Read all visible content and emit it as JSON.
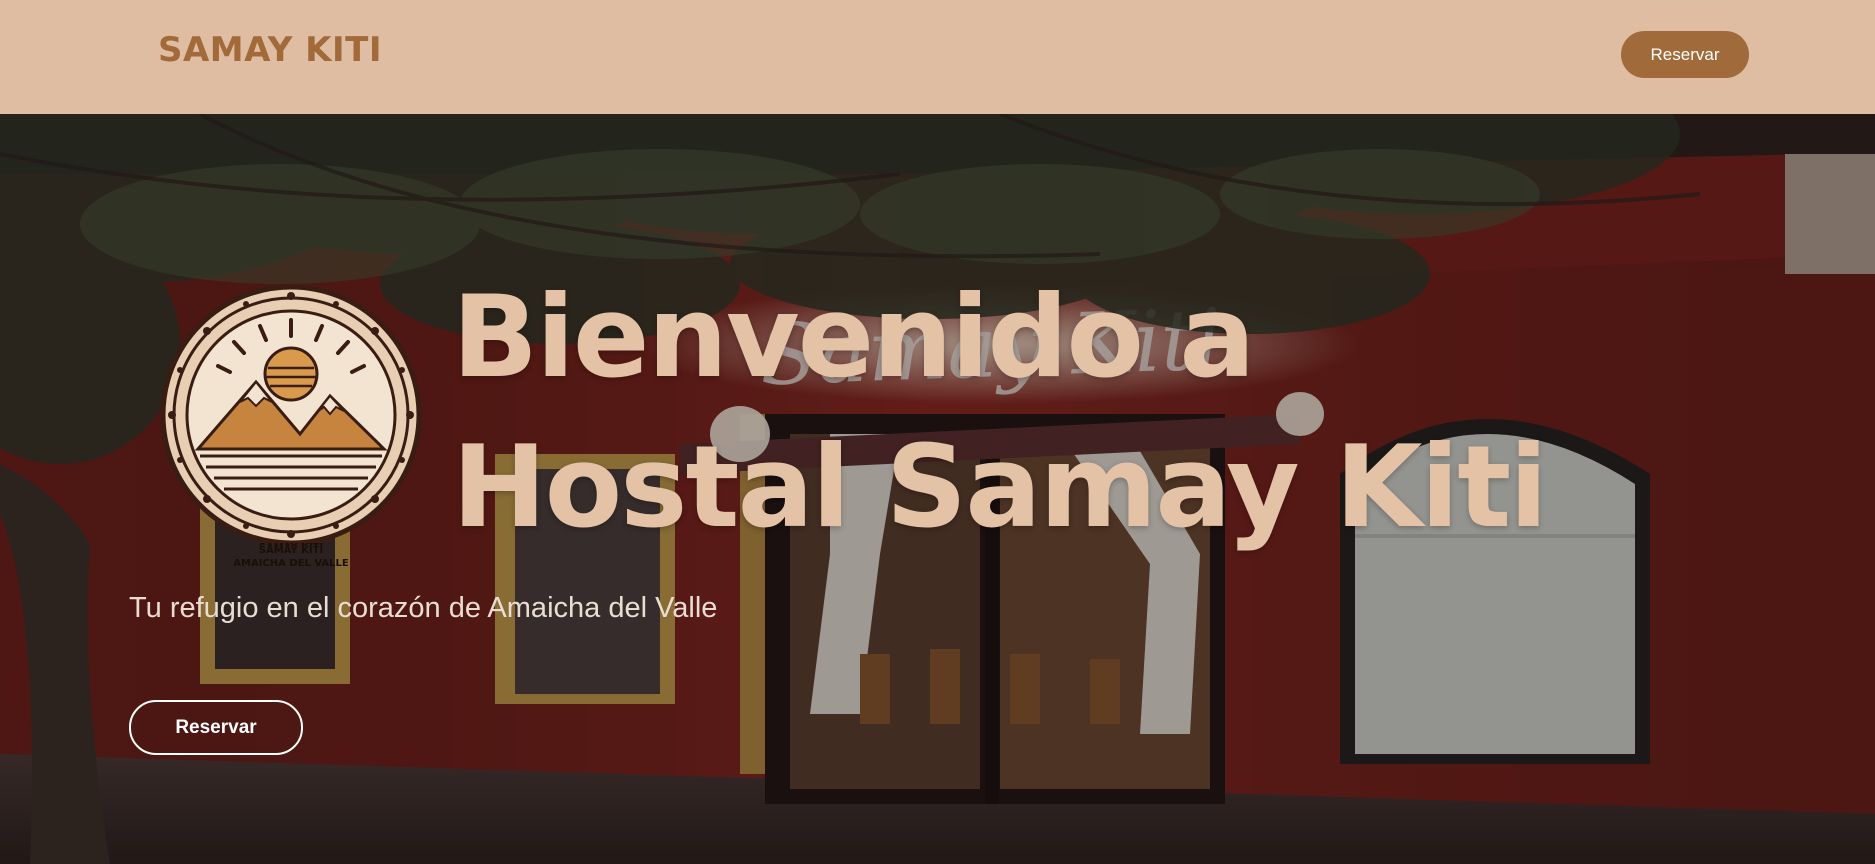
{
  "header": {
    "brand": "SAMAY KITI",
    "reserve_label": "Reservar"
  },
  "hero": {
    "title_line1": "Bienvenido a",
    "title_line2": "Hostal Samay Kiti",
    "subtitle": "Tu refugio en el corazón de Amaicha del Valle",
    "reserve_label": "Reservar",
    "background_sign": "Samay Kiti",
    "logo": {
      "line1": "SAMAY KITI",
      "line2": "AMAICHA DEL VALLE"
    }
  },
  "colors": {
    "header_bg": "#dfbda3",
    "brand": "#a16a38",
    "accent_button": "#a06a3a",
    "hero_title": "#e4c2a6",
    "wall_red": "#8e2a22"
  }
}
